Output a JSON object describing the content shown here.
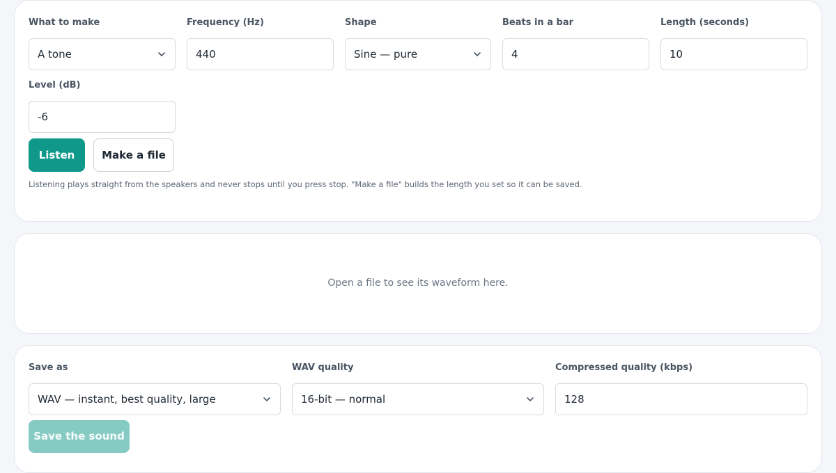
{
  "generate": {
    "what_to_make": {
      "label": "What to make",
      "value": "A tone"
    },
    "frequency": {
      "label": "Frequency (Hz)",
      "value": "440"
    },
    "shape": {
      "label": "Shape",
      "value": "Sine — pure"
    },
    "beats": {
      "label": "Beats in a bar",
      "value": "4"
    },
    "length": {
      "label": "Length (seconds)",
      "value": "10"
    },
    "level": {
      "label": "Level (dB)",
      "value": "-6"
    },
    "listen_label": "Listen",
    "make_file_label": "Make a file",
    "hint": "Listening plays straight from the speakers and never stops until you press stop. \"Make a file\" builds the length you set so it can be saved."
  },
  "waveform": {
    "empty_text": "Open a file to see its waveform here."
  },
  "export": {
    "save_as": {
      "label": "Save as",
      "value": "WAV — instant, best quality, large"
    },
    "wav_quality": {
      "label": "WAV quality",
      "value": "16-bit — normal"
    },
    "compressed_quality": {
      "label": "Compressed quality (kbps)",
      "value": "128"
    },
    "save_label": "Save the sound",
    "save_disabled": true
  },
  "icons": {
    "select_arrow": "chevron-down-icon"
  },
  "colors": {
    "accent": "#10998a",
    "accent_disabled": "#86cbc3",
    "background": "#f5f6fa"
  }
}
